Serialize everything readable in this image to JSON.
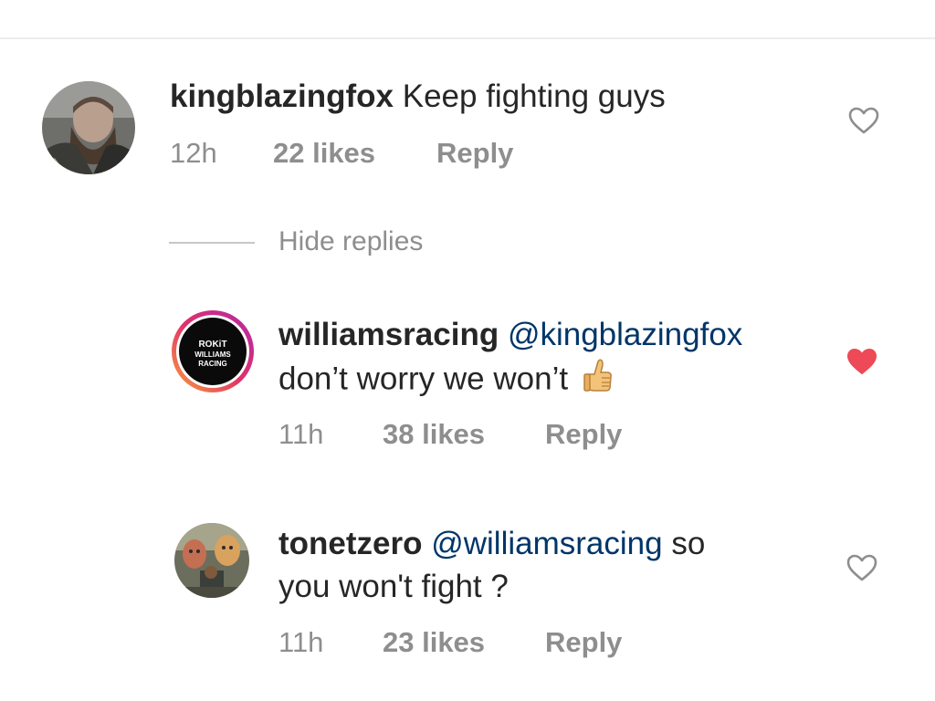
{
  "comments": [
    {
      "username": "kingblazingfox",
      "text": " Keep fighting guys",
      "time": "12h",
      "likes": "22 likes",
      "reply": "Reply",
      "liked": false
    },
    {
      "username": "williamsracing",
      "mention": " @kingblazingfox",
      "text_line2": "don’t worry we won’t",
      "emoji": "👍",
      "avatar_text": [
        "ROKiT",
        "WILLIAMS",
        "RACING"
      ],
      "time": "11h",
      "likes": "38 likes",
      "reply": "Reply",
      "liked": true
    },
    {
      "username": "tonetzero",
      "mention": " @williamsracing",
      "text_line1_tail": " so",
      "text_line2": "you won't fight ?",
      "time": "11h",
      "likes": "23 likes",
      "reply": "Reply",
      "liked": false
    }
  ],
  "hide_replies": "Hide replies",
  "colors": {
    "text": "#262626",
    "meta": "#8e8e8e",
    "mention": "#003569",
    "heart_liked": "#ed4956",
    "heart_outline": "#8e8e8e"
  }
}
